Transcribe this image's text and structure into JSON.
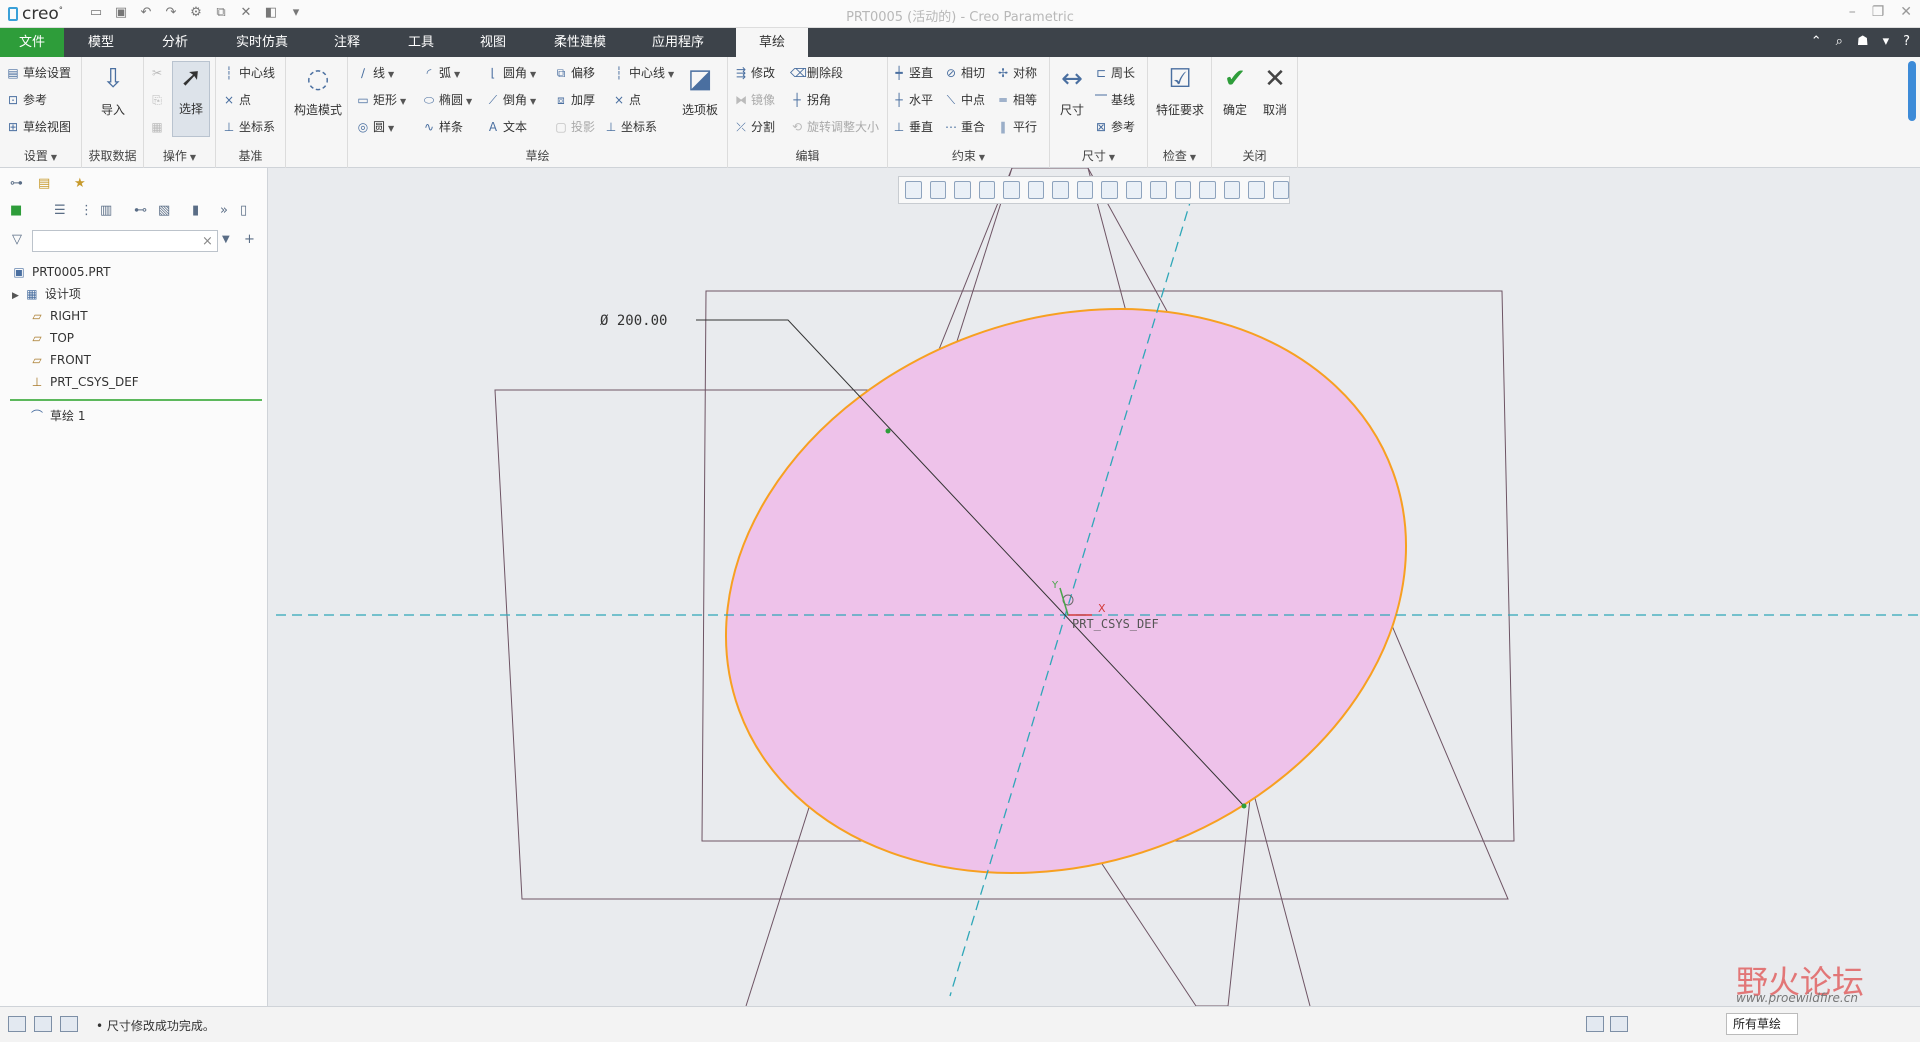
{
  "titlebar": {
    "app_name": "creo",
    "window_title": "PRT0005 (活动的) - Creo Parametric"
  },
  "menu_tabs": [
    {
      "label": "文件",
      "state": "file"
    },
    {
      "label": "模型"
    },
    {
      "label": "分析"
    },
    {
      "label": "实时仿真"
    },
    {
      "label": "注释"
    },
    {
      "label": "工具"
    },
    {
      "label": "视图"
    },
    {
      "label": "柔性建模"
    },
    {
      "label": "应用程序"
    },
    {
      "label": "草绘",
      "state": "active"
    }
  ],
  "ribbon": {
    "setup": {
      "label": "设置",
      "items": [
        "草绘设置",
        "参考",
        "草绘视图"
      ]
    },
    "get_data": {
      "label": "获取数据",
      "import": "导入"
    },
    "operations": {
      "label": "操作",
      "select": "选择"
    },
    "datum": {
      "label": "基准",
      "items": [
        "中心线",
        "点",
        "坐标系"
      ]
    },
    "construction": {
      "label": "构造模式"
    },
    "sketch": {
      "label": "草绘",
      "col1": [
        "线",
        "矩形",
        "圆"
      ],
      "col2": [
        "弧",
        "椭圆",
        "样条"
      ],
      "col3": [
        "圆角",
        "倒角",
        "文本"
      ],
      "col4": [
        "偏移",
        "加厚",
        "投影"
      ],
      "col5": [
        "中心线",
        "点",
        "坐标系"
      ],
      "palette": "选项板"
    },
    "edit": {
      "label": "编辑",
      "items": [
        "修改",
        "镜像",
        "分割",
        "删除段",
        "拐角",
        "旋转调整大小"
      ]
    },
    "constrain": {
      "label": "约束",
      "items": [
        "竖直",
        "水平",
        "垂直",
        "相切",
        "中点",
        "重合",
        "对称",
        "相等",
        "平行"
      ]
    },
    "dimension": {
      "label": "尺寸",
      "dim": "尺寸",
      "items": [
        "周长",
        "基线",
        "参考"
      ]
    },
    "inspect": {
      "label": "检查",
      "feature_req": "特征要求"
    },
    "close": {
      "label": "关闭",
      "ok": "确定",
      "cancel": "取消"
    }
  },
  "model_tree": {
    "filter_placeholder": "",
    "items": [
      {
        "label": "PRT0005.PRT",
        "icon": "part-icon"
      },
      {
        "label": "设计项",
        "icon": "design-items-icon"
      },
      {
        "label": "RIGHT",
        "icon": "datum-plane-icon"
      },
      {
        "label": "TOP",
        "icon": "datum-plane-icon"
      },
      {
        "label": "FRONT",
        "icon": "datum-plane-icon"
      },
      {
        "label": "PRT_CSYS_DEF",
        "icon": "csys-icon"
      },
      {
        "label": "草绘 1",
        "icon": "sketch-icon"
      }
    ]
  },
  "graphics": {
    "dimension_label": "Ø 200.00",
    "csys_label": "PRT_CSYS_DEF",
    "axis_x": "X",
    "axis_y": "Y",
    "colors": {
      "ellipse_fill": "#eec2ea",
      "ellipse_stroke": "#f7a021",
      "datum": "#6e5464",
      "centerline": "#2fa7b8"
    }
  },
  "statusbar": {
    "message": "• 尺寸修改成功完成。",
    "filter_value": "所有草绘"
  },
  "watermark": {
    "text": "野火论坛",
    "url": "www.proewildfire.cn"
  }
}
